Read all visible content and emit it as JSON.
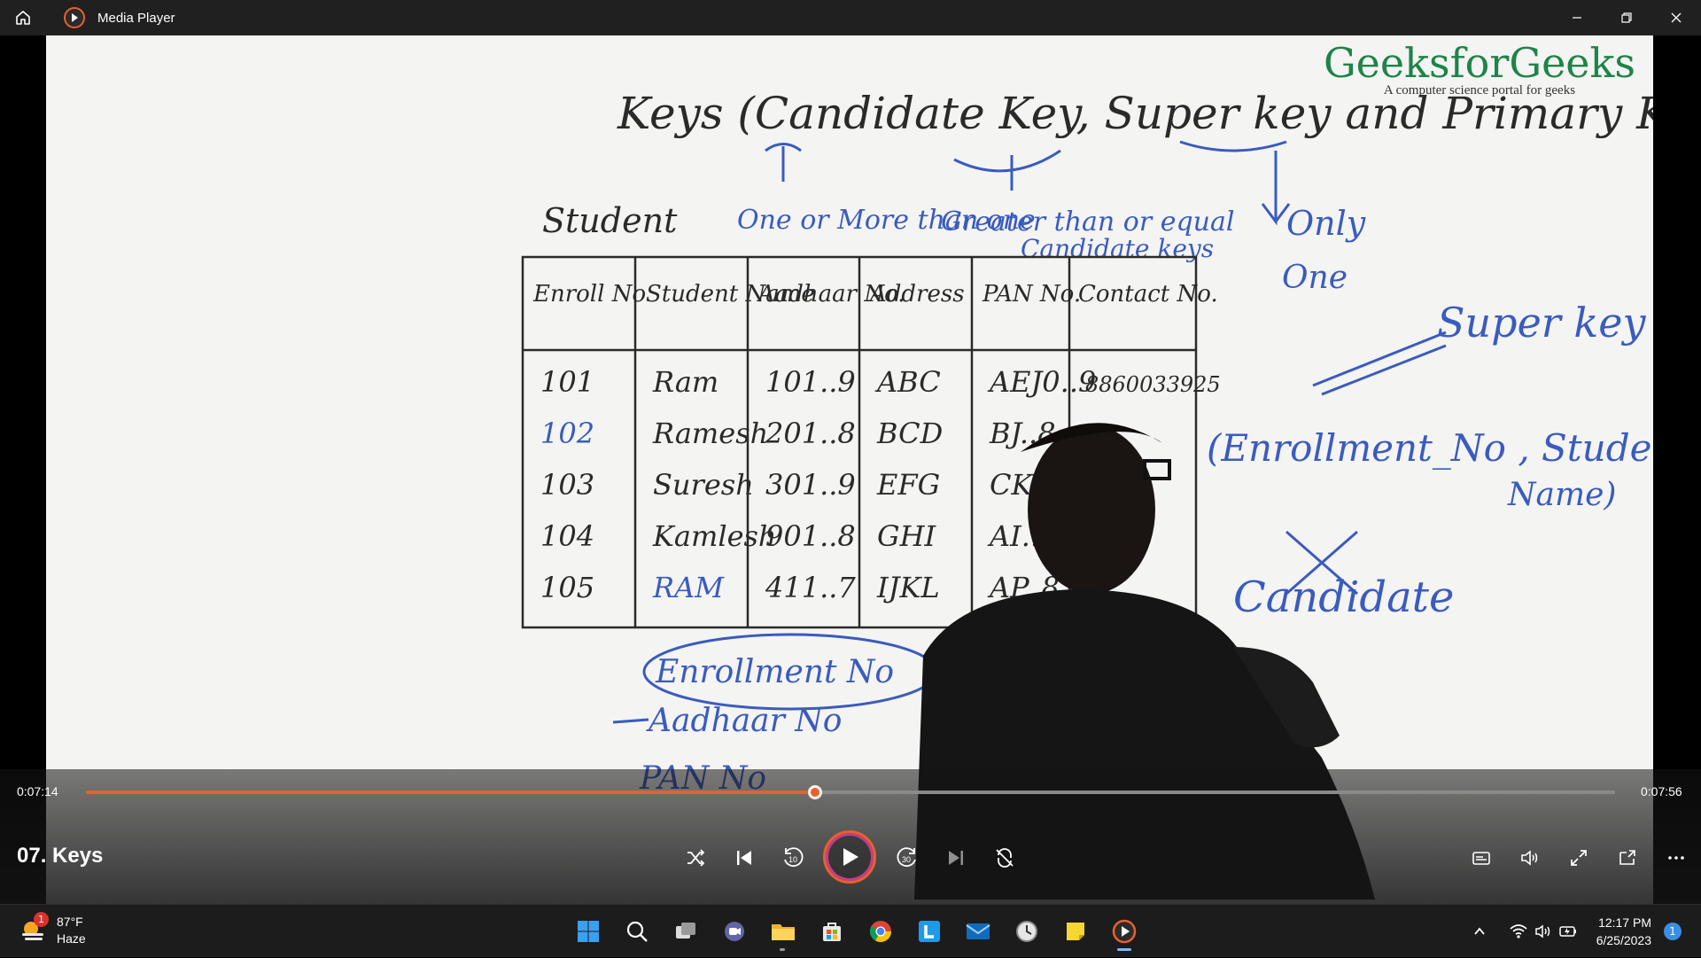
{
  "window": {
    "title": "Media Player"
  },
  "video": {
    "logo_name": "GeeksforGeeks",
    "logo_tagline": "A computer science portal for geeks",
    "whiteboard": {
      "title": "Keys (Candidate Key, Super key and Primary Key)",
      "table_name": "Student",
      "note_candidate": "One or More than one",
      "note_super_line1": "Greater than or equal",
      "note_super_line2": "Candidate keys",
      "note_primary_1": "Only",
      "note_primary_2": "One",
      "table_headers": [
        "Enroll No",
        "Student Name",
        "Aadhaar No.",
        "Address",
        "PAN No.",
        "Contact No."
      ],
      "table_rows": [
        [
          "101",
          "Ram",
          "101..9",
          "ABC",
          "AEJ0..9",
          "8860033925"
        ],
        [
          "102",
          "Ramesh",
          "201..8",
          "BCD",
          "BJ..8",
          ""
        ],
        [
          "103",
          "Suresh",
          "301..9",
          "EFG",
          "CK..",
          ""
        ],
        [
          "104",
          "Kamlesh",
          "901..8",
          "GHI",
          "AI..",
          ""
        ],
        [
          "105",
          "RAM",
          "411..7",
          "IJKL",
          "AP..8",
          ""
        ]
      ],
      "superkey_label": "Super key",
      "superkey_example_1": "(Enrollment_No , Student",
      "superkey_example_2": "Name)",
      "candidate_label": "Candidate",
      "list_items": [
        "Enrollment No",
        "Aadhaar No",
        "PAN No"
      ]
    }
  },
  "player": {
    "current_time": "0:07:14",
    "total_time": "0:07:56",
    "progress_fraction": 0.477,
    "track_title": "07. Keys",
    "seek_back_label": "10",
    "seek_forward_label": "30",
    "icons": [
      "shuffle-icon",
      "previous-icon",
      "skip-back-10-icon",
      "play-icon",
      "skip-forward-30-icon",
      "next-icon",
      "repeat-off-icon",
      "subtitles-icon",
      "volume-icon",
      "fullscreen-icon",
      "mini-player-icon",
      "more-icon"
    ]
  },
  "taskbar": {
    "weather_temp": "87°F",
    "weather_desc": "Haze",
    "weather_badge": "1",
    "time": "12:17 PM",
    "date": "6/25/2023",
    "notification_count": "1",
    "apps": [
      "start",
      "search",
      "task-view",
      "teams",
      "file-explorer",
      "store",
      "chrome",
      "l-app",
      "mail",
      "clock",
      "sticky-notes",
      "media-player"
    ]
  },
  "colors": {
    "accent": "#e8612c",
    "gfg_green": "#1e8449",
    "marker_blue": "#3a5bbf",
    "marker_black": "#2a2a2a"
  }
}
